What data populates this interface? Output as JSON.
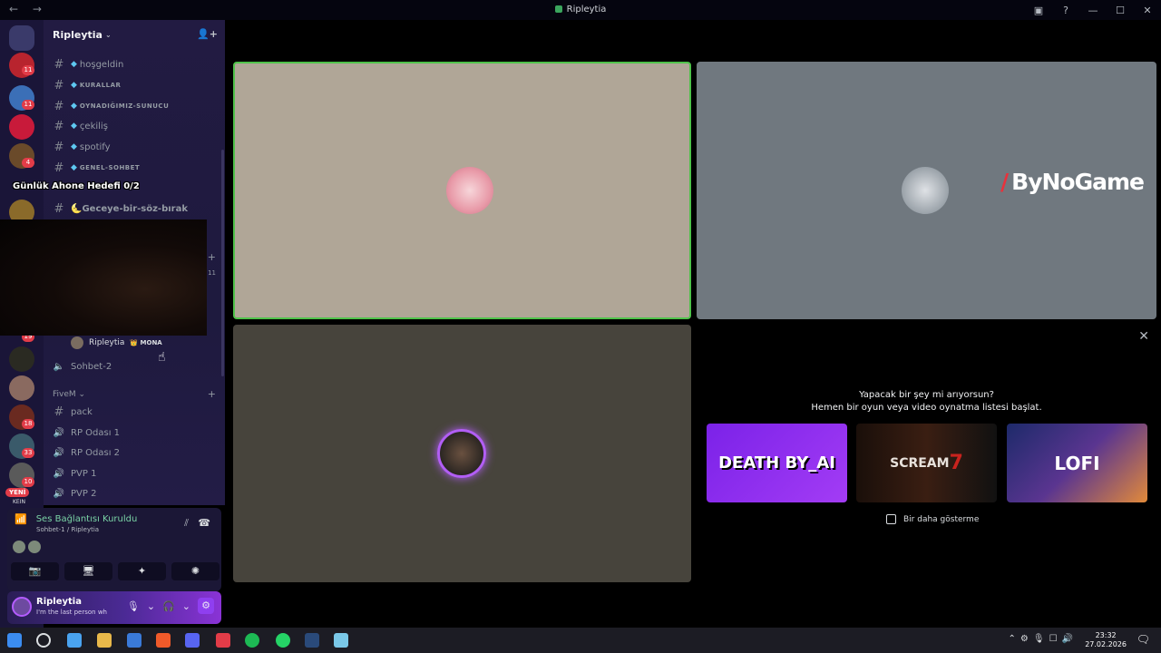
{
  "window": {
    "title": "Ripleytia",
    "nav": "← →",
    "controls": [
      "▣",
      "?",
      "—",
      "☐",
      "✕"
    ]
  },
  "server_rail": {
    "badges": [
      "11",
      "11",
      "4",
      "19",
      "18",
      "33",
      "10"
    ],
    "new_label": "YENİ",
    "new_sub": "KEIN"
  },
  "guild": {
    "name": "Ripleytia",
    "channels": [
      {
        "icon": "#",
        "gem": true,
        "label": "hoşgeldin"
      },
      {
        "icon": "#",
        "gem": true,
        "label": "KURALLAR",
        "small": true
      },
      {
        "icon": "#",
        "gem": true,
        "label": "OYNADIĞIMIZ-SUNUCU",
        "small": true
      },
      {
        "icon": "#",
        "gem": true,
        "label": "çekiliş"
      },
      {
        "icon": "#",
        "gem": true,
        "label": "spotify"
      },
      {
        "icon": "#",
        "gem": true,
        "label": "GENEL-SOHBET",
        "small": true
      },
      {
        "icon": "#",
        "gem": false,
        "label": "🌜Geceye-bir-söz-bırak"
      }
    ],
    "overlay_text": "Günlük Ahone Hedefi 0/2",
    "hidden_count": "11",
    "voice_user": {
      "name": "Ripleytia",
      "tag": "👑 MONA"
    },
    "voice_channel": "Sohbet-2",
    "category": "FiveM",
    "five_channels": [
      {
        "icon": "#",
        "label": "pack"
      },
      {
        "icon": "🔊",
        "label": "RP Odası 1"
      },
      {
        "icon": "🔊",
        "label": "RP Odası 2"
      },
      {
        "icon": "🔊",
        "label": "PVP 1"
      },
      {
        "icon": "🔊",
        "label": "PVP 2"
      }
    ]
  },
  "voice_panel": {
    "status": "Ses Bağlantısı Kuruldu",
    "channel": "Sohbet-1 / Ripleytia",
    "buttons": [
      "📷",
      "🖥",
      "✦",
      "✺"
    ]
  },
  "user_panel": {
    "name": "Ripleytia",
    "status": "I'm the last person wh"
  },
  "stage": {
    "brand": "ByNoGame",
    "activity": {
      "line1": "Yapacak bir şey mi arıyorsun?",
      "line2": "Hemen bir oyun veya video oynatma listesi başlat.",
      "cards": [
        "DEATH BY_AI",
        "SCREAM",
        "LOFI"
      ],
      "dont_show": "Bir daha gösterme"
    }
  },
  "taskbar": {
    "time": "23:32",
    "date": "27.02.2026"
  }
}
